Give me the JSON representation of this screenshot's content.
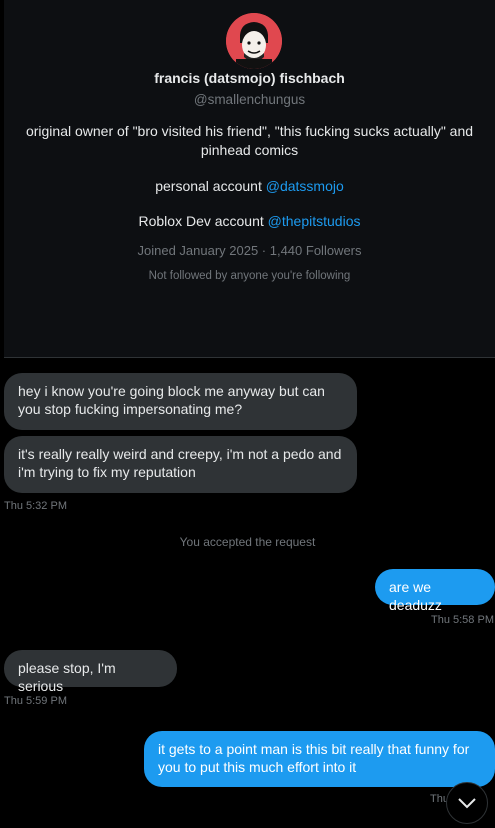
{
  "profile": {
    "display_name": "francis (datsmojo) fischbach",
    "handle": "@smallenchungus",
    "bio": "original owner of \"bro visited his friend\", \"this fucking sucks actually\" and pinhead comics",
    "personal_label": "personal account ",
    "personal_link": "@datssmojo",
    "roblox_label": "Roblox Dev account ",
    "roblox_link": "@thepitstudios",
    "joined": "Joined January 2025 · 1,440 Followers",
    "not_followed": "Not followed by anyone you're following"
  },
  "messages": [
    {
      "direction": "in",
      "text": "hey i know you're going block me anyway but can you stop fucking impersonating me?"
    },
    {
      "direction": "in",
      "text": "it's really really weird and creepy, i'm not a pedo and i'm trying to fix my reputation"
    },
    {
      "direction": "out",
      "text": "are we deaduzz"
    },
    {
      "direction": "in",
      "text": "please stop, I'm serious"
    },
    {
      "direction": "out",
      "text": "it gets to a point man is this bit really that funny for you to put this much effort into it"
    }
  ],
  "timestamps": {
    "t1": "Thu 5:32 PM",
    "t2": "Thu 5:58 PM",
    "t3": "Thu 5:59 PM",
    "t4": "Thu"
  },
  "system_message": "You accepted the request",
  "colors": {
    "accent": "#1d9bf0",
    "incoming_bubble": "#2f3336",
    "avatar_bg": "#e0484f"
  }
}
